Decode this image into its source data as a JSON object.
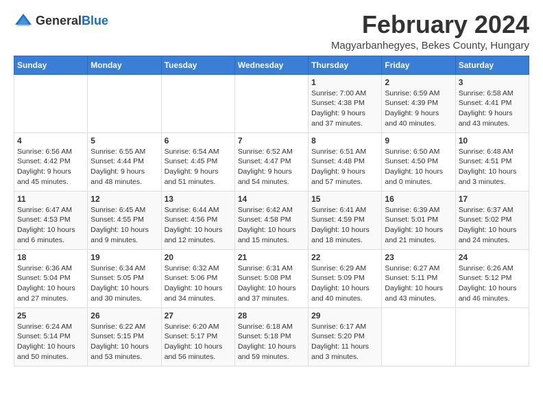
{
  "logo": {
    "general": "General",
    "blue": "Blue"
  },
  "title": "February 2024",
  "subtitle": "Magyarbanhegyes, Bekes County, Hungary",
  "days_of_week": [
    "Sunday",
    "Monday",
    "Tuesday",
    "Wednesday",
    "Thursday",
    "Friday",
    "Saturday"
  ],
  "weeks": [
    [
      {
        "day": "",
        "info": ""
      },
      {
        "day": "",
        "info": ""
      },
      {
        "day": "",
        "info": ""
      },
      {
        "day": "",
        "info": ""
      },
      {
        "day": "1",
        "info": "Sunrise: 7:00 AM\nSunset: 4:38 PM\nDaylight: 9 hours\nand 37 minutes."
      },
      {
        "day": "2",
        "info": "Sunrise: 6:59 AM\nSunset: 4:39 PM\nDaylight: 9 hours\nand 40 minutes."
      },
      {
        "day": "3",
        "info": "Sunrise: 6:58 AM\nSunset: 4:41 PM\nDaylight: 9 hours\nand 43 minutes."
      }
    ],
    [
      {
        "day": "4",
        "info": "Sunrise: 6:56 AM\nSunset: 4:42 PM\nDaylight: 9 hours\nand 45 minutes."
      },
      {
        "day": "5",
        "info": "Sunrise: 6:55 AM\nSunset: 4:44 PM\nDaylight: 9 hours\nand 48 minutes."
      },
      {
        "day": "6",
        "info": "Sunrise: 6:54 AM\nSunset: 4:45 PM\nDaylight: 9 hours\nand 51 minutes."
      },
      {
        "day": "7",
        "info": "Sunrise: 6:52 AM\nSunset: 4:47 PM\nDaylight: 9 hours\nand 54 minutes."
      },
      {
        "day": "8",
        "info": "Sunrise: 6:51 AM\nSunset: 4:48 PM\nDaylight: 9 hours\nand 57 minutes."
      },
      {
        "day": "9",
        "info": "Sunrise: 6:50 AM\nSunset: 4:50 PM\nDaylight: 10 hours\nand 0 minutes."
      },
      {
        "day": "10",
        "info": "Sunrise: 6:48 AM\nSunset: 4:51 PM\nDaylight: 10 hours\nand 3 minutes."
      }
    ],
    [
      {
        "day": "11",
        "info": "Sunrise: 6:47 AM\nSunset: 4:53 PM\nDaylight: 10 hours\nand 6 minutes."
      },
      {
        "day": "12",
        "info": "Sunrise: 6:45 AM\nSunset: 4:55 PM\nDaylight: 10 hours\nand 9 minutes."
      },
      {
        "day": "13",
        "info": "Sunrise: 6:44 AM\nSunset: 4:56 PM\nDaylight: 10 hours\nand 12 minutes."
      },
      {
        "day": "14",
        "info": "Sunrise: 6:42 AM\nSunset: 4:58 PM\nDaylight: 10 hours\nand 15 minutes."
      },
      {
        "day": "15",
        "info": "Sunrise: 6:41 AM\nSunset: 4:59 PM\nDaylight: 10 hours\nand 18 minutes."
      },
      {
        "day": "16",
        "info": "Sunrise: 6:39 AM\nSunset: 5:01 PM\nDaylight: 10 hours\nand 21 minutes."
      },
      {
        "day": "17",
        "info": "Sunrise: 6:37 AM\nSunset: 5:02 PM\nDaylight: 10 hours\nand 24 minutes."
      }
    ],
    [
      {
        "day": "18",
        "info": "Sunrise: 6:36 AM\nSunset: 5:04 PM\nDaylight: 10 hours\nand 27 minutes."
      },
      {
        "day": "19",
        "info": "Sunrise: 6:34 AM\nSunset: 5:05 PM\nDaylight: 10 hours\nand 30 minutes."
      },
      {
        "day": "20",
        "info": "Sunrise: 6:32 AM\nSunset: 5:06 PM\nDaylight: 10 hours\nand 34 minutes."
      },
      {
        "day": "21",
        "info": "Sunrise: 6:31 AM\nSunset: 5:08 PM\nDaylight: 10 hours\nand 37 minutes."
      },
      {
        "day": "22",
        "info": "Sunrise: 6:29 AM\nSunset: 5:09 PM\nDaylight: 10 hours\nand 40 minutes."
      },
      {
        "day": "23",
        "info": "Sunrise: 6:27 AM\nSunset: 5:11 PM\nDaylight: 10 hours\nand 43 minutes."
      },
      {
        "day": "24",
        "info": "Sunrise: 6:26 AM\nSunset: 5:12 PM\nDaylight: 10 hours\nand 46 minutes."
      }
    ],
    [
      {
        "day": "25",
        "info": "Sunrise: 6:24 AM\nSunset: 5:14 PM\nDaylight: 10 hours\nand 50 minutes."
      },
      {
        "day": "26",
        "info": "Sunrise: 6:22 AM\nSunset: 5:15 PM\nDaylight: 10 hours\nand 53 minutes."
      },
      {
        "day": "27",
        "info": "Sunrise: 6:20 AM\nSunset: 5:17 PM\nDaylight: 10 hours\nand 56 minutes."
      },
      {
        "day": "28",
        "info": "Sunrise: 6:18 AM\nSunset: 5:18 PM\nDaylight: 10 hours\nand 59 minutes."
      },
      {
        "day": "29",
        "info": "Sunrise: 6:17 AM\nSunset: 5:20 PM\nDaylight: 11 hours\nand 3 minutes."
      },
      {
        "day": "",
        "info": ""
      },
      {
        "day": "",
        "info": ""
      }
    ]
  ]
}
